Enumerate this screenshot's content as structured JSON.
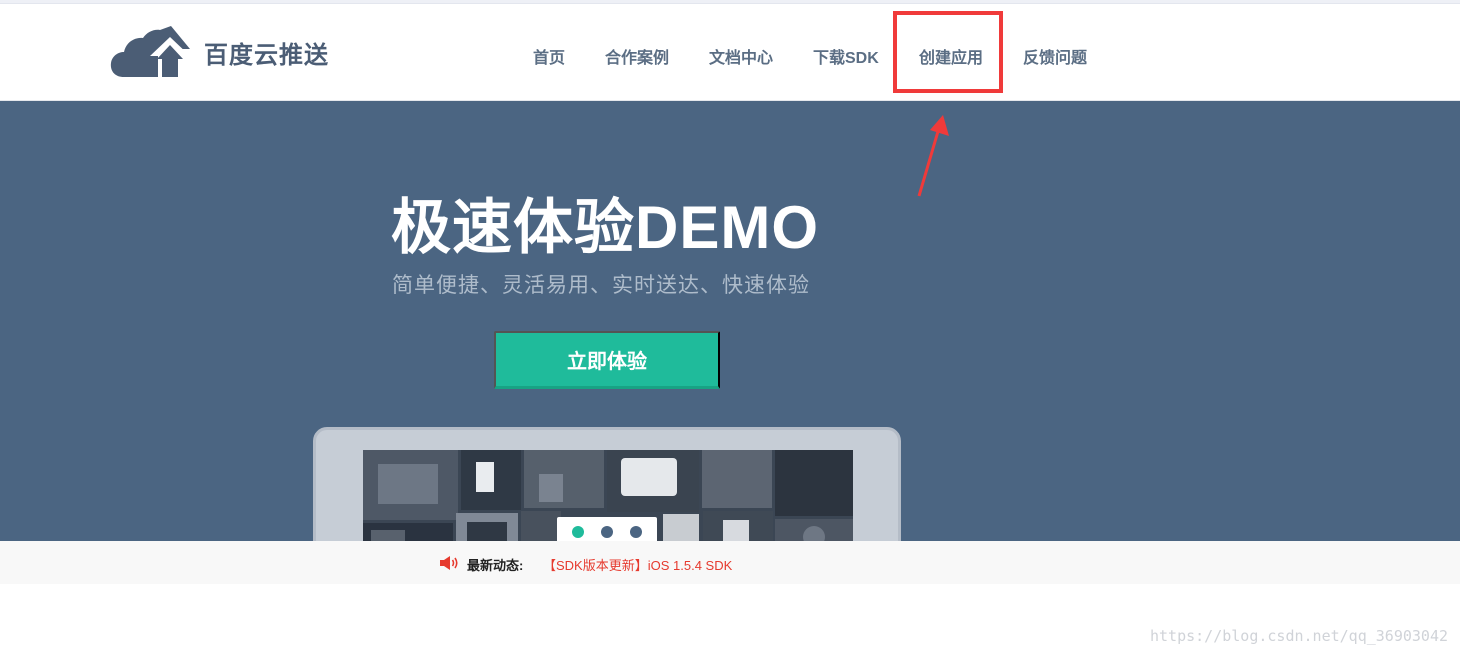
{
  "brand": {
    "name": "百度云推送",
    "logo_icon": "cloud-arrow-icon",
    "color": "#4b5d75"
  },
  "nav": {
    "items": [
      {
        "label": "首页"
      },
      {
        "label": "合作案例"
      },
      {
        "label": "文档中心"
      },
      {
        "label": "下载SDK"
      },
      {
        "label": "创建应用",
        "highlighted": true
      },
      {
        "label": "反馈问题"
      }
    ]
  },
  "hero": {
    "title": "极速体验DEMO",
    "subtitle": "简单便捷、灵活易用、实时送达、快速体验",
    "cta_label": "立即体验",
    "background": "#4b6582",
    "cta_color": "#1fbb9b",
    "carousel": {
      "slides": 3,
      "active_index": 0
    }
  },
  "news": {
    "icon": "speaker-icon",
    "label": "最新动态:",
    "link_text": "【SDK版本更新】iOS 1.5.4 SDK",
    "link_color": "#e63a2e"
  },
  "annotation": {
    "color": "#f03a3a"
  },
  "watermark": "https://blog.csdn.net/qq_36903042"
}
